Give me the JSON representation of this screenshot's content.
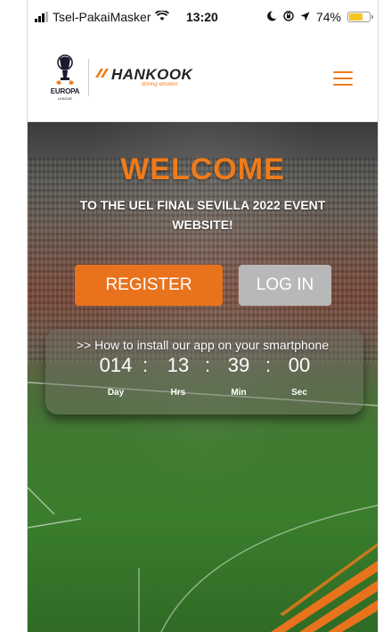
{
  "status_bar": {
    "carrier": "Tsel-PakaiMasker",
    "time": "13:20",
    "battery_percent": "74%",
    "battery_level": 0.74,
    "battery_color": "#f3c623",
    "icons": [
      "signal-bars-icon",
      "wifi-icon",
      "do-not-disturb-icon",
      "screen-lock-rotation-icon",
      "location-arrow-icon",
      "battery-icon"
    ]
  },
  "header": {
    "uel_logo": {
      "word": "EUROPA",
      "sub": "LEAGUE"
    },
    "sponsor_logo": {
      "brand": "Hankook",
      "slogan": "driving emotion"
    },
    "menu_icon": "hamburger-menu-icon",
    "accent_color": "#f07b1a"
  },
  "hero": {
    "welcome": "WELCOME",
    "subtitle": "TO THE UEL FINAL SEVILLA 2022 EVENT WEBSITE!",
    "register_label": "REGISTER",
    "login_label": "LOG IN",
    "install_link": ">> How to install our app on your smartphone"
  },
  "countdown": {
    "days": "014",
    "hours": "13",
    "minutes": "39",
    "seconds": "00",
    "separator": ":",
    "labels": {
      "days": "Day",
      "hours": "Hrs",
      "minutes": "Min",
      "seconds": "Sec"
    }
  },
  "colors": {
    "brand_orange": "#e9731d",
    "login_gray": "#b8b8b8"
  }
}
